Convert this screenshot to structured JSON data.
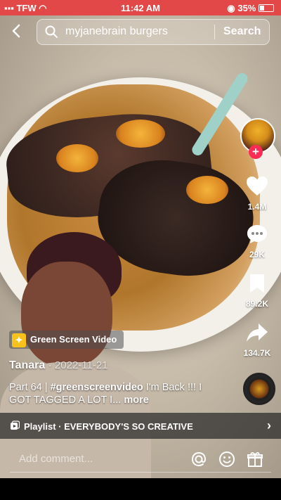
{
  "status_bar": {
    "carrier": "TFW",
    "time": "11:42 AM",
    "battery": "35%"
  },
  "search": {
    "query": "myjanebrain burgers",
    "button_label": "Search"
  },
  "actions": {
    "likes": "1.4M",
    "comments": "29K",
    "saves": "89.2K",
    "shares": "134.7K"
  },
  "effect": {
    "label": "Green Screen Video"
  },
  "post": {
    "author": "Tanara",
    "date": "· 2022-11-21",
    "caption_start": "Part 64 | ",
    "hashtag": "#greenscreenvideo",
    "caption_rest": "  I'm Back !!! I GOT TAGGED A LOT I... ",
    "more": "more"
  },
  "playlist": {
    "label": "Playlist · EVERYBODY'S SO CREATIVE"
  },
  "comment": {
    "placeholder": "Add comment..."
  },
  "colors": {
    "status_bar": "#e24848",
    "follow_badge": "#fe2c55"
  },
  "icons": [
    "back-icon",
    "search-icon",
    "heart-icon",
    "comment-icon",
    "bookmark-icon",
    "share-icon",
    "playlist-icon",
    "chevron-right-icon",
    "mention-icon",
    "emoji-icon",
    "gift-icon"
  ]
}
